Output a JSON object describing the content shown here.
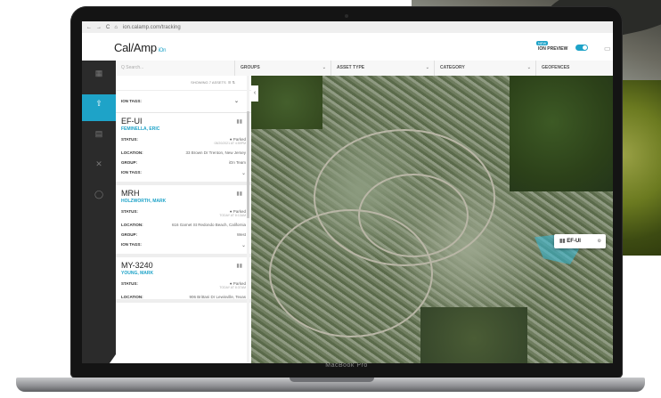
{
  "browser": {
    "nav_icons": [
      "←",
      "→",
      "C",
      "⌂"
    ],
    "url": "ion.calamp.com/tracking"
  },
  "app": {
    "logo_text": "Cal/Amp",
    "logo_sub": "iOn",
    "new_badge": "NEW",
    "ion_preview_label": "ION PREVIEW",
    "ion_preview_on": true
  },
  "filters": {
    "search_placeholder": "Q Search...",
    "groups": "GROUPS",
    "asset_type": "ASSET TYPE",
    "category": "CATEGORY",
    "geofences": "GEOFENCES"
  },
  "list": {
    "header": "SHOWING 7 ASSETS",
    "ion_tags_label": "ION TAGS:",
    "assets": [
      {
        "name": "EF-UI",
        "owner": "FEMINELLA, ERIC",
        "status": "● Parked",
        "status_time": "08/20/2021 AT 4:59PM",
        "location": "33 Brown Dr Trenton, New Jersey",
        "group": "iOn Team"
      },
      {
        "name": "MRH",
        "owner": "HOLZWORTH, MARK",
        "status": "● Parked",
        "status_time": "TODAY AT 8:13AM",
        "location": "616 Garnet St Redondo Beach, California",
        "group": "West"
      },
      {
        "name": "MY-3240",
        "owner": "YOUNG, MARK",
        "status": "● Parked",
        "status_time": "TODAY AT 8:37AM",
        "location": "906 Brittani Dr Lewisville, Texas",
        "group": ""
      }
    ],
    "labels": {
      "status": "STATUS:",
      "location": "LOCATION:",
      "group": "GROUP:",
      "ion_tags": "ION TAGS:"
    }
  },
  "map": {
    "marker_label": "EF-UI"
  },
  "device": {
    "brand": "MacBook Pro"
  }
}
